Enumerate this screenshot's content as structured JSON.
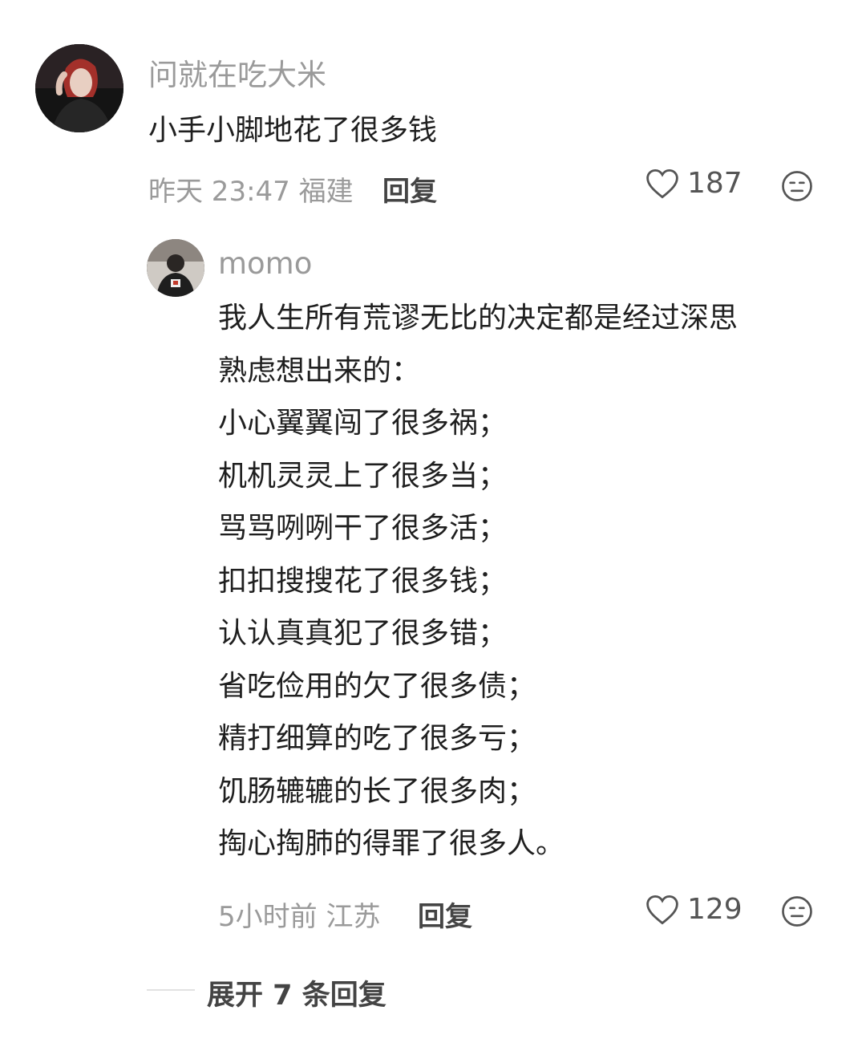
{
  "comment": {
    "username": "问就在吃大米",
    "text": "小手小脚地花了很多钱",
    "time": "昨天 23:47",
    "location": "福建",
    "reply_label": "回复",
    "likes": "187"
  },
  "reply": {
    "username": "momo",
    "lines": [
      "我人生所有荒谬无比的决定都是经过深思",
      "熟虑想出来的：",
      "小心翼翼闯了很多祸；",
      "机机灵灵上了很多当；",
      "骂骂咧咧干了很多活；",
      "扣扣搜搜花了很多钱；",
      "认认真真犯了很多错；",
      "省吃俭用的欠了很多债；",
      "精打细算的吃了很多亏；",
      "饥肠辘辘的长了很多肉；",
      "掏心掏肺的得罪了很多人。"
    ],
    "time": "5小时前",
    "location": "江苏",
    "reply_label": "回复",
    "likes": "129"
  },
  "expand_replies": "展开 7 条回复"
}
